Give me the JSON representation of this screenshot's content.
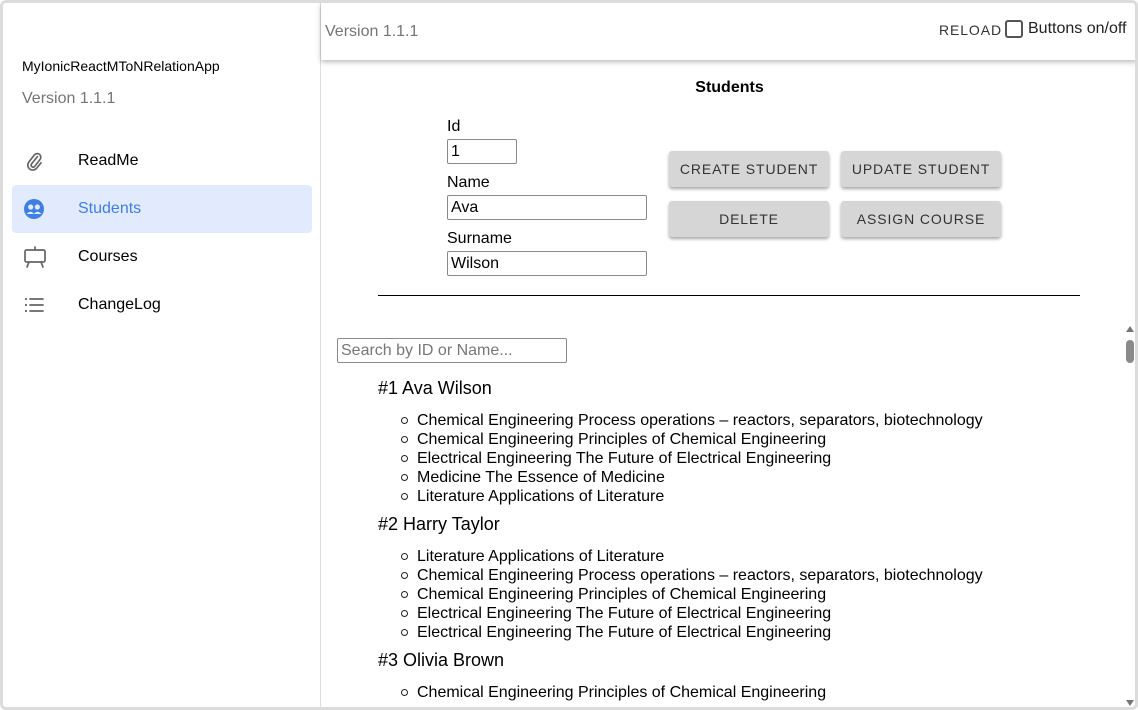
{
  "sidebar": {
    "app_title": "MyIonicReactMToNRelationApp",
    "version": "Version 1.1.1",
    "items": [
      {
        "label": "ReadMe",
        "icon": "paperclip-icon",
        "active": false
      },
      {
        "label": "Students",
        "icon": "people-circle-icon",
        "active": true
      },
      {
        "label": "Courses",
        "icon": "easel-icon",
        "active": false
      },
      {
        "label": "ChangeLog",
        "icon": "list-icon",
        "active": false
      }
    ]
  },
  "header": {
    "version": "Version 1.1.1",
    "reload_label": "RELOAD",
    "toggle_label": "Buttons on/off",
    "toggle_checked": false
  },
  "main": {
    "title": "Students",
    "form": {
      "id_label": "Id",
      "id_value": "1",
      "name_label": "Name",
      "name_value": "Ava",
      "surname_label": "Surname",
      "surname_value": "Wilson"
    },
    "buttons": {
      "create": "CREATE STUDENT",
      "update": "UPDATE STUDENT",
      "delete": "DELETE",
      "assign": "ASSIGN COURSE"
    },
    "search_placeholder": "Search by ID or Name...",
    "students": [
      {
        "name": "#1 Ava Wilson",
        "courses": [
          "Chemical Engineering Process operations – reactors, separators, biotechnology",
          "Chemical Engineering Principles of Chemical Engineering",
          "Electrical Engineering The Future of Electrical Engineering",
          "Medicine The Essence of Medicine",
          "Literature Applications of Literature"
        ]
      },
      {
        "name": "#2 Harry Taylor",
        "courses": [
          "Literature Applications of Literature",
          "Chemical Engineering Process operations – reactors, separators, biotechnology",
          "Chemical Engineering Principles of Chemical Engineering",
          "Electrical Engineering The Future of Electrical Engineering",
          "Electrical Engineering The Future of Electrical Engineering"
        ]
      },
      {
        "name": "#3 Olivia Brown",
        "courses": [
          "Chemical Engineering Principles of Chemical Engineering"
        ]
      }
    ]
  },
  "colors": {
    "active_bg": "#e2ebfd",
    "active_text": "#3f7fe0",
    "button_bg": "#d6d6d6",
    "muted_text": "#757575"
  }
}
